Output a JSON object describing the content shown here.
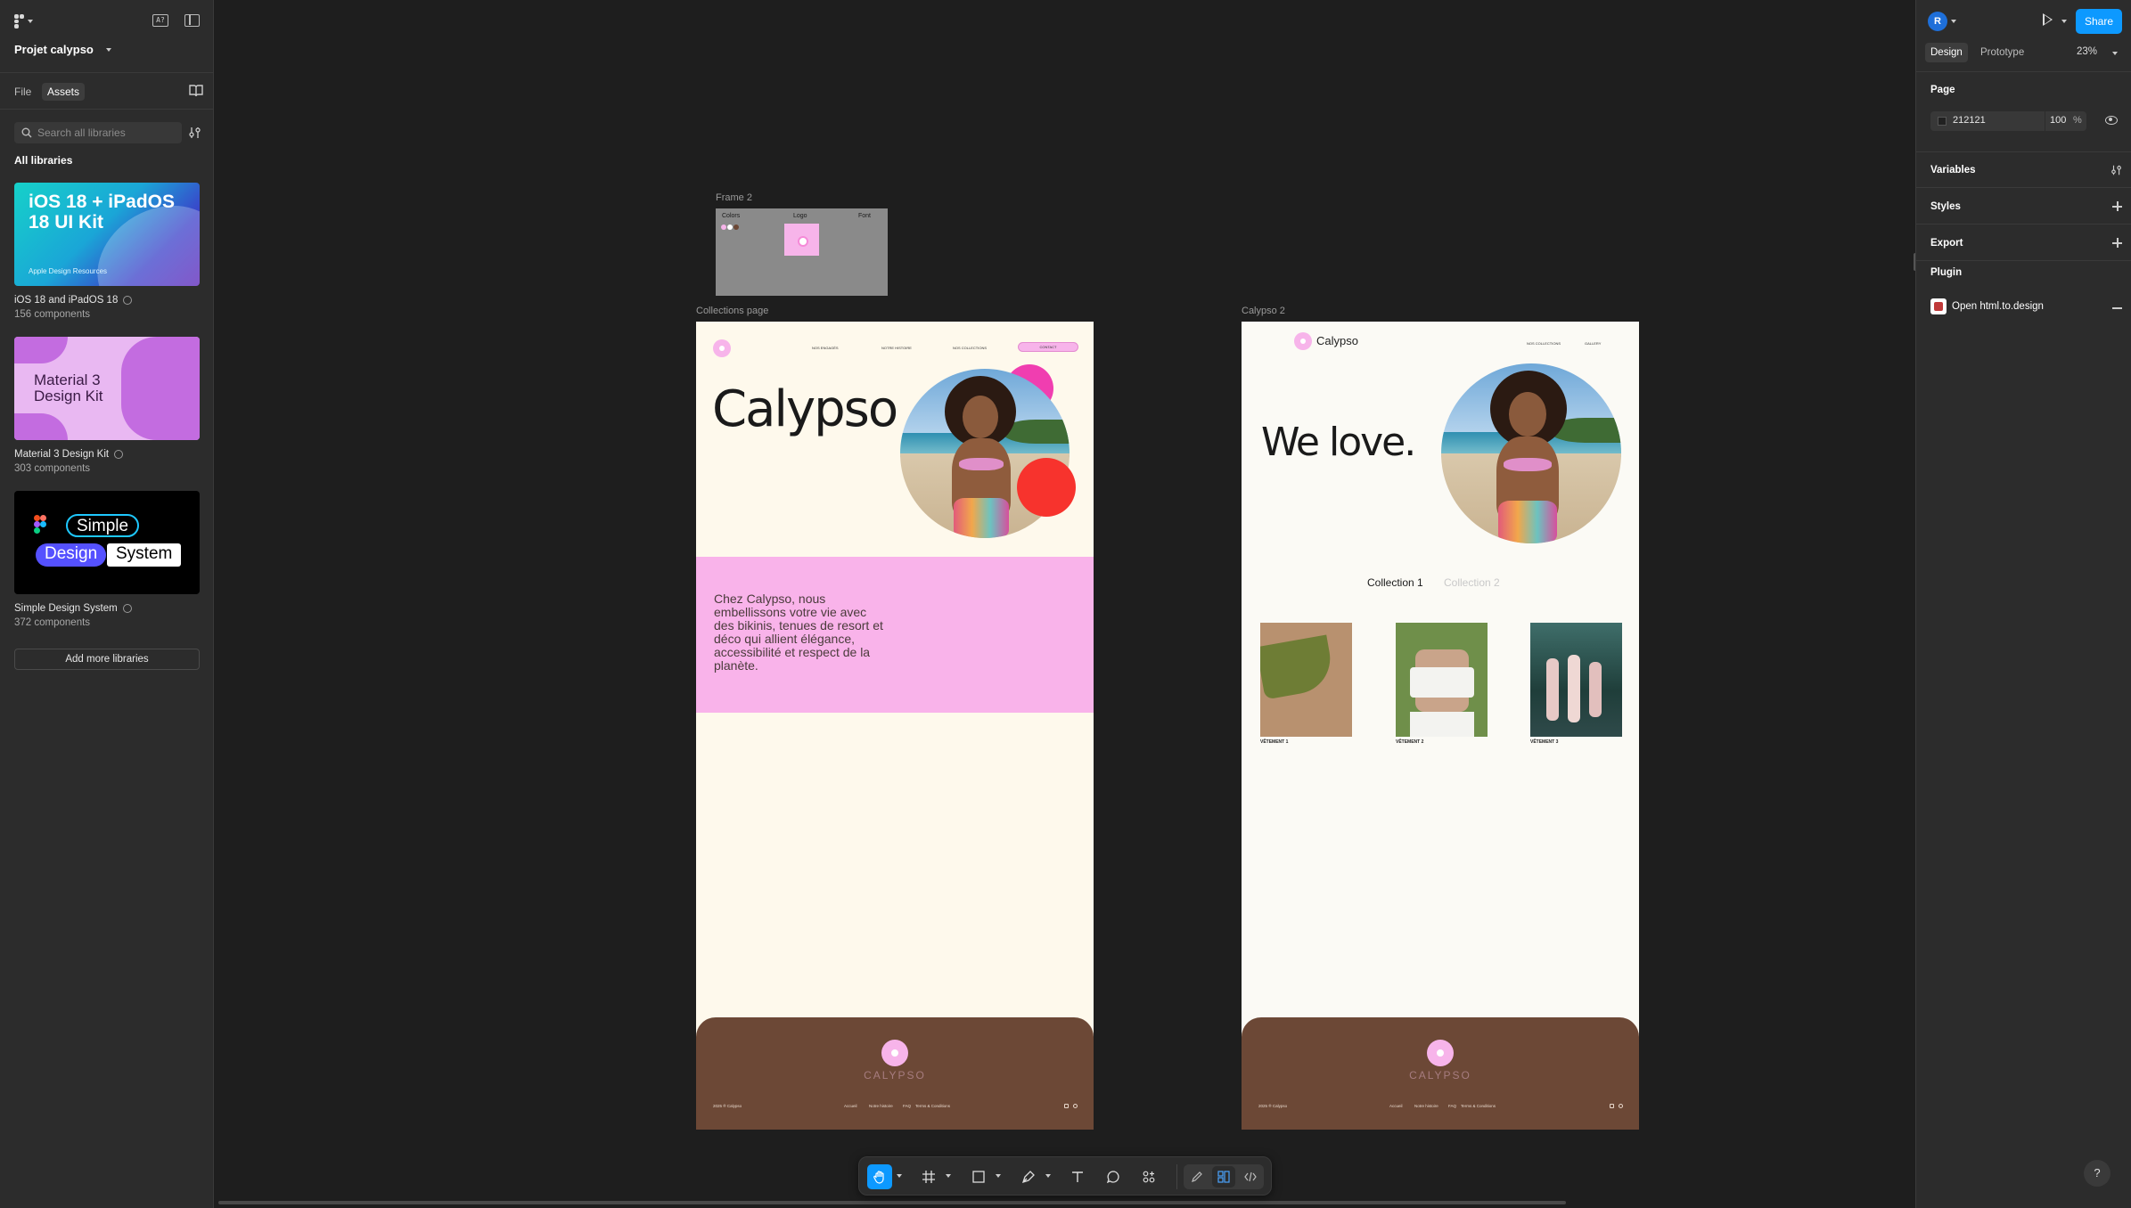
{
  "left_panel": {
    "project_name": "Projet calypso",
    "tabs": [
      "File",
      "Assets"
    ],
    "active_tab": "Assets",
    "search": {
      "placeholder": "Search all libraries",
      "value": ""
    },
    "all_libraries_label": "All libraries",
    "libraries": [
      {
        "name": "iOS 18 and iPadOS 18",
        "count": "156 components",
        "thumb_title": "iOS 18 + iPadOS 18 UI Kit",
        "thumb_sub": "Apple Design Resources"
      },
      {
        "name": "Material 3 Design Kit",
        "count": "303 components",
        "thumb_title": "Material 3 Design Kit"
      },
      {
        "name": "Simple Design System",
        "count": "372 components",
        "thumb_words": [
          "Simple",
          "Design",
          "System"
        ]
      }
    ],
    "add_more_label": "Add more libraries"
  },
  "canvas": {
    "frame2": {
      "label": "Frame 2",
      "headers": [
        "Colors",
        "Logo",
        "Font"
      ],
      "swatches": [
        "#f7b4ea",
        "#ffffff",
        "#6c4836"
      ]
    },
    "collections_page": {
      "label": "Collections page",
      "nav_links": [
        "NOS ENGAGÉS",
        "NOTRE HISTOIRE",
        "NOS COLLECTIONS"
      ],
      "contact_label": "CONTACT",
      "hero_title": "Calypso",
      "description": "Chez Calypso, nous embellissons votre vie avec des bikinis, tenues de resort et déco qui allient élégance, accessibilité et respect de la  planète."
    },
    "calypso2": {
      "label": "Calypso 2",
      "brand": "Calypso",
      "nav_links": [
        "NOS COLLECTIONS",
        "GALLERY"
      ],
      "hero_title": "We love.",
      "collection_tabs": [
        "Collection 1",
        "Collection 2"
      ],
      "products": [
        "VÊTEMENT 1",
        "VÊTEMENT 2",
        "VÊTEMENT 3"
      ]
    },
    "footer": {
      "brand": "CALYPSO",
      "copyright": "2025 ® Calypso",
      "links_page1": [
        "Accueil",
        "Notre histoire",
        "FAQ",
        "Terms & Conditions"
      ],
      "links_page2": [
        "Accueil",
        "Notre histoire",
        "FAQ",
        "Terms & Conditions"
      ]
    }
  },
  "right_panel": {
    "avatar_initial": "R",
    "share_label": "Share",
    "tabs": [
      "Design",
      "Prototype"
    ],
    "active_tab": "Design",
    "zoom": "23%",
    "page_section": "Page",
    "page_color_hex": "212121",
    "page_opacity": "100",
    "percent_sign": "%",
    "sections": [
      "Variables",
      "Styles",
      "Export",
      "Plugin"
    ],
    "plugin_name": "Open html.to.design"
  },
  "colors": {
    "accent": "#0d99ff",
    "pink": "#f9b3ea",
    "brown": "#6c4836",
    "cream": "#fef9ec"
  }
}
